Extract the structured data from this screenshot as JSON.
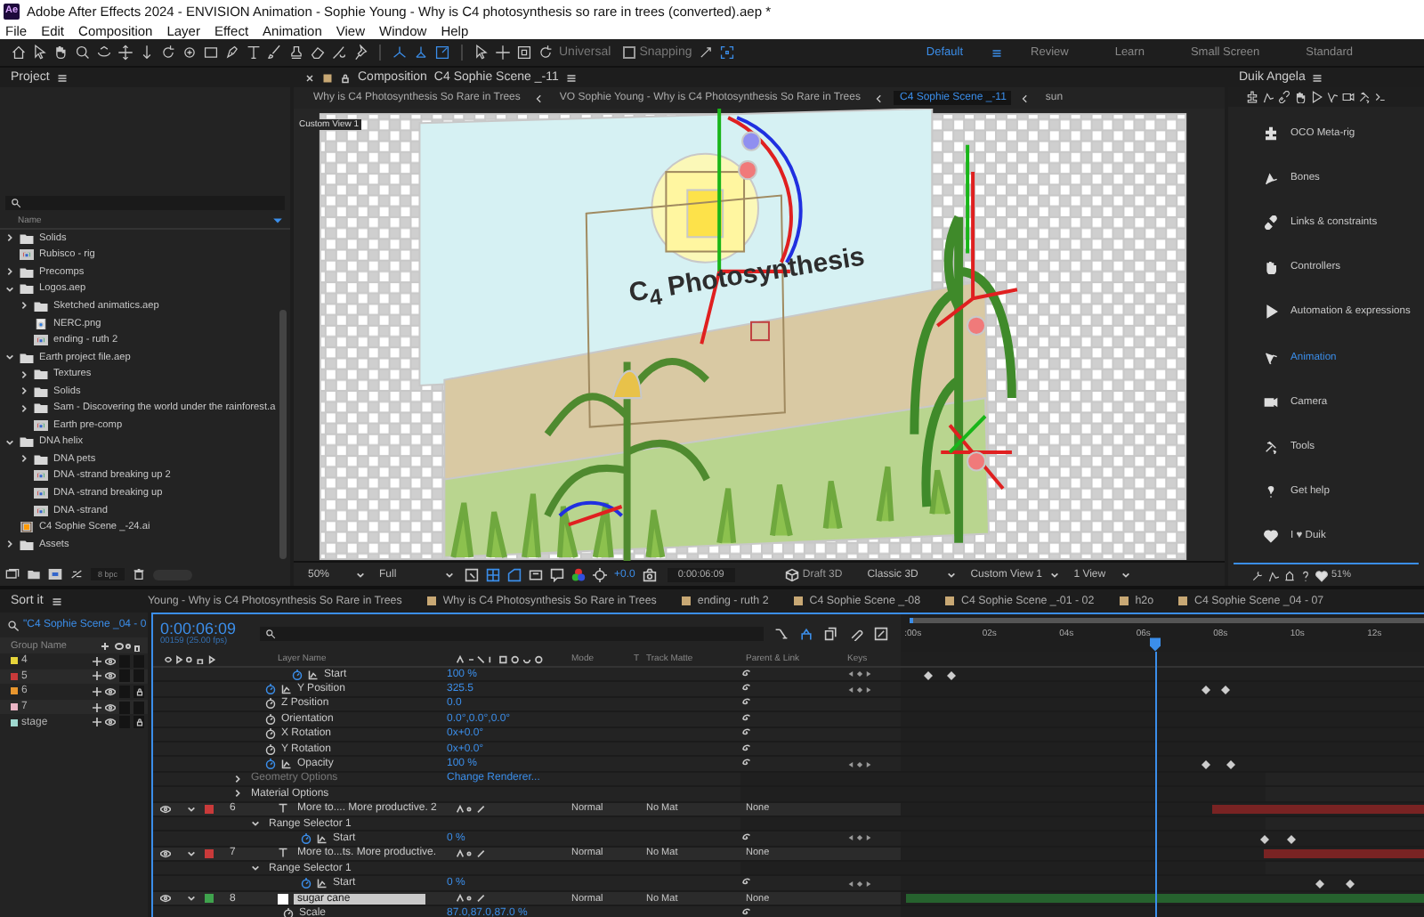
{
  "window": {
    "logo": "Ae",
    "title": "Adobe After Effects 2024 - ENVISION Animation - Sophie Young - Why is C4 photosynthesis so rare in trees (converted).aep *"
  },
  "menu": [
    "File",
    "Edit",
    "Composition",
    "Layer",
    "Effect",
    "Animation",
    "View",
    "Window",
    "Help"
  ],
  "toolbar": {
    "universal": "Universal",
    "snapping": "Snapping",
    "snapping_checked": false
  },
  "workspaces": [
    {
      "label": "Default",
      "selected": true
    },
    {
      "label": "Review",
      "selected": false
    },
    {
      "label": "Learn",
      "selected": false
    },
    {
      "label": "Small Screen",
      "selected": false
    },
    {
      "label": "Standard",
      "selected": false
    }
  ],
  "project": {
    "title": "Project",
    "column": "Name",
    "depth_label": "8 bpc",
    "items": [
      {
        "kind": "folder",
        "name": "Solids",
        "expanded": false
      },
      {
        "kind": "comp",
        "name": "Rubisco - rig"
      },
      {
        "kind": "folder",
        "name": "Precomps",
        "expanded": false
      },
      {
        "kind": "folder",
        "name": "Logos.aep",
        "expanded": true,
        "children": [
          {
            "kind": "folder",
            "name": "Sketched animatics.aep",
            "expanded": false
          },
          {
            "kind": "image",
            "name": "NERC.png"
          },
          {
            "kind": "comp",
            "name": "ending - ruth 2"
          }
        ]
      },
      {
        "kind": "folder",
        "name": "Earth project file.aep",
        "expanded": true,
        "children": [
          {
            "kind": "folder",
            "name": "Textures",
            "expanded": false
          },
          {
            "kind": "folder",
            "name": "Solids",
            "expanded": false
          },
          {
            "kind": "folder",
            "name": "Sam - Discovering the world under the rainforest.a",
            "expanded": false
          },
          {
            "kind": "comp",
            "name": "Earth pre-comp"
          }
        ]
      },
      {
        "kind": "folder",
        "name": "DNA helix",
        "expanded": true,
        "children": [
          {
            "kind": "folder",
            "name": "DNA pets",
            "expanded": false
          },
          {
            "kind": "comp",
            "name": "DNA -strand breaking up 2"
          },
          {
            "kind": "comp",
            "name": "DNA -strand breaking up"
          },
          {
            "kind": "comp",
            "name": "DNA -strand"
          }
        ]
      },
      {
        "kind": "ai",
        "name": "C4 Sophie Scene _-24.ai"
      },
      {
        "kind": "folder",
        "name": "Assets",
        "expanded": false
      }
    ]
  },
  "composition": {
    "panel_title": "Composition",
    "comp_name": "C4 Sophie Scene _-11",
    "breadcrumbs": [
      {
        "label": "Why is C4 Photosynthesis So Rare in Trees",
        "selected": false
      },
      {
        "label": "VO Sophie Young - Why is C4 Photosynthesis So Rare in Trees",
        "selected": false
      },
      {
        "label": "C4 Sophie Scene _-11",
        "selected": true
      },
      {
        "label": "sun",
        "selected": false
      }
    ],
    "view_label": "Custom View 1",
    "artwork_text": "C$_{4}$ Photosynthesis",
    "controls": {
      "zoom": "50%",
      "resolution": "Full",
      "exposure": "+0.0",
      "time": "0:00:06:09",
      "draft": "Draft 3D",
      "renderer": "Classic 3D",
      "view": "Custom View 1",
      "layout": "1 View"
    }
  },
  "duik": {
    "title": "Duik Angela",
    "items": [
      {
        "label": "OCO Meta-rig",
        "selected": false
      },
      {
        "label": "Bones",
        "selected": false
      },
      {
        "label": "Links & constraints",
        "selected": false
      },
      {
        "label": "Controllers",
        "selected": false
      },
      {
        "label": "Automation & expressions",
        "selected": false
      },
      {
        "label": "Animation",
        "selected": true
      },
      {
        "label": "Camera",
        "selected": false
      },
      {
        "label": "Tools",
        "selected": false
      },
      {
        "label": "Get help",
        "selected": false
      },
      {
        "label": "I ♥ Duik",
        "selected": false
      }
    ],
    "footer": "51%"
  },
  "sort_it": {
    "title": "Sort it",
    "search": "\"C4 Sophie Scene _04 - 0",
    "column": "Group Name",
    "groups": [
      {
        "name": "4",
        "color": "#e6d43a",
        "locked": false
      },
      {
        "name": "5",
        "color": "#c93a3a",
        "locked": false
      },
      {
        "name": "6",
        "color": "#e8962e",
        "locked": true
      },
      {
        "name": "7",
        "color": "#eab4c4",
        "locked": false
      },
      {
        "name": "stage",
        "color": "#9fd8cf",
        "locked": true
      }
    ]
  },
  "timeline": {
    "tabs": [
      {
        "label": "Young - Why is C4 Photosynthesis So Rare in Trees",
        "selected": false
      },
      {
        "label": "Why is C4 Photosynthesis So Rare in Trees",
        "selected": false
      },
      {
        "label": "ending - ruth 2",
        "selected": false
      },
      {
        "label": "C4 Sophie Scene _-08",
        "selected": false
      },
      {
        "label": "C4 Sophie Scene _-01 - 02",
        "selected": false
      },
      {
        "label": "h2o",
        "selected": false
      },
      {
        "label": "C4 Sophie Scene _04 - 07",
        "selected": false
      }
    ],
    "timecode": "0:00:06:09",
    "frames": "00159 (25.00 fps)",
    "columns": {
      "name": "Layer Name",
      "mode": "Mode",
      "t": "T",
      "matte": "Track Matte",
      "parent": "Parent & Link",
      "keys": "Keys"
    },
    "ruler": [
      ":00s",
      "02s",
      "04s",
      "06s",
      "08s",
      "10s",
      "12s"
    ],
    "playhead": {
      "level": 0.485
    },
    "rows": [
      {
        "kind": "property",
        "name": "Start",
        "value": "100 %",
        "nested": true,
        "stopwatch": true,
        "graph": true,
        "keyframes": [
          {
            "level": 0.054
          },
          {
            "level": 0.098
          }
        ]
      },
      {
        "kind": "property",
        "name": "Y Position",
        "value": "325.5",
        "stopwatch": true,
        "graph": true,
        "keyframes": [
          {
            "level": 0.583
          },
          {
            "level": 0.62
          }
        ]
      },
      {
        "kind": "property",
        "name": "Z Position",
        "value": "0.0",
        "stopwatch": false,
        "graph": false
      },
      {
        "kind": "property",
        "name": "Orientation",
        "value": "0.0°,0.0°,0.0°",
        "stopwatch": false,
        "graph": false
      },
      {
        "kind": "property",
        "name": "X Rotation",
        "value": "0x+0.0°",
        "stopwatch": false,
        "graph": false
      },
      {
        "kind": "property",
        "name": "Y Rotation",
        "value": "0x+0.0°",
        "stopwatch": false,
        "graph": false
      },
      {
        "kind": "property",
        "name": "Opacity",
        "value": "100 %",
        "stopwatch": true,
        "graph": true,
        "keyframes": [
          {
            "level": 0.583
          },
          {
            "level": 0.628
          }
        ]
      },
      {
        "kind": "group",
        "name": "Geometry Options",
        "value": "Change Renderer...",
        "disabled": true,
        "expanded": false
      },
      {
        "kind": "group",
        "name": "Material Options",
        "disabled": false,
        "expanded": false
      },
      {
        "kind": "layer",
        "number": "6",
        "source": {
          "kind": "text"
        },
        "name": "More to.... More productive. 2",
        "color": "#c93a3a",
        "editing": false,
        "mode": "Normal",
        "matte": "No Mat",
        "parent": "None",
        "expanded": true,
        "bar": {
          "level": 0.407
        },
        "children": [
          {
            "kind": "group",
            "name": "Range Selector 1",
            "disabled": false,
            "expanded": true,
            "children": [
              {
                "kind": "property",
                "name": "Start",
                "value": "0 %",
                "stopwatch": true,
                "graph": true,
                "keyframes": [
                  {
                    "level": 0.694
                  },
                  {
                    "level": 0.745
                  }
                ]
              }
            ]
          }
        ]
      },
      {
        "kind": "layer",
        "number": "7",
        "source": {
          "kind": "text"
        },
        "name": "More to...ts. More productive.",
        "color": "#c93a3a",
        "editing": false,
        "mode": "Normal",
        "matte": "No Mat",
        "parent": "None",
        "expanded": true,
        "bar": {
          "level": 0.31
        },
        "children": [
          {
            "kind": "group",
            "name": "Range Selector 1",
            "disabled": false,
            "expanded": true,
            "children": [
              {
                "kind": "property",
                "name": "Start",
                "value": "0 %",
                "stopwatch": true,
                "graph": true,
                "keyframes": [
                  {
                    "level": 0.797
                  },
                  {
                    "level": 0.856
                  }
                ]
              }
            ]
          }
        ]
      },
      {
        "kind": "layer",
        "number": "8",
        "source": {
          "kind": "solid"
        },
        "name": "sugar cane",
        "color": "#3fa34d",
        "editing": true,
        "mode": "Normal",
        "matte": "No Mat",
        "parent": "None",
        "expanded": true,
        "bar": {
          "level": 0.99
        },
        "children": [
          {
            "kind": "property",
            "name": "Scale",
            "value": "87.0,87.0,87.0 %",
            "stopwatch": false,
            "graph": false
          }
        ]
      }
    ]
  }
}
